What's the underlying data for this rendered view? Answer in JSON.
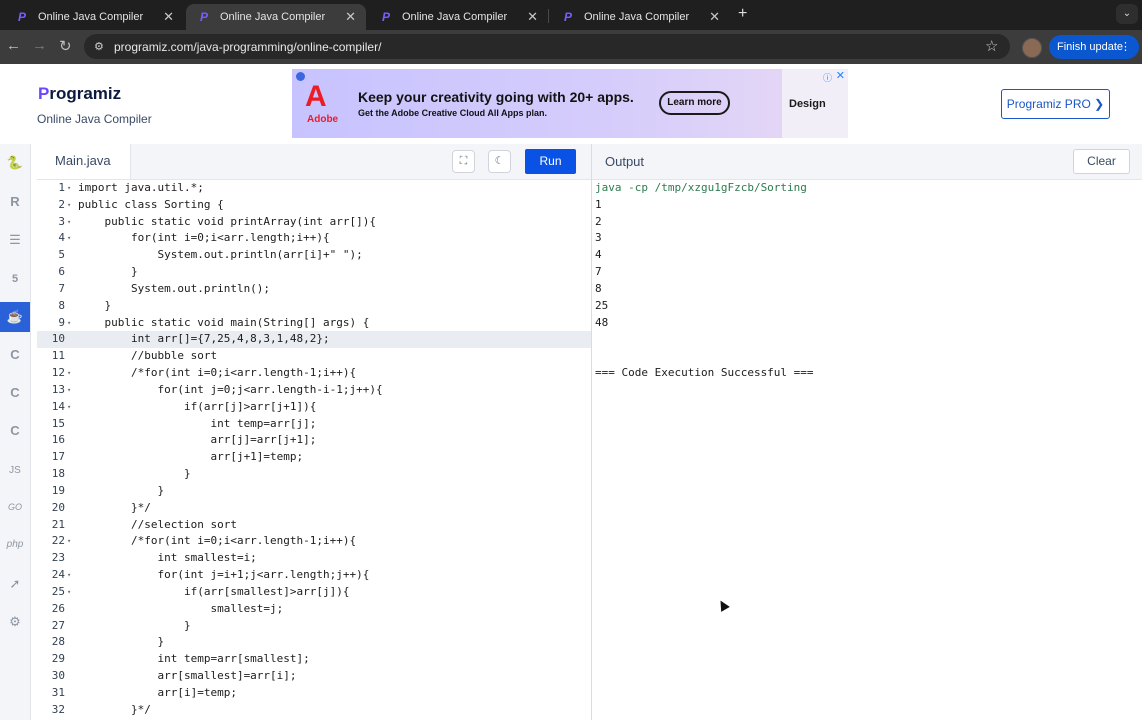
{
  "browser": {
    "tabs": [
      {
        "title": "Online Java Compiler",
        "active": false
      },
      {
        "title": "Online Java Compiler",
        "active": true
      },
      {
        "title": "Online Java Compiler",
        "active": false
      },
      {
        "title": "Online Java Compiler",
        "active": false
      }
    ],
    "url": "programiz.com/java-programming/online-compiler/",
    "update_button": "Finish update"
  },
  "header": {
    "logo": "rogramiz",
    "logo_initial": "P",
    "subtitle": "Online Java Compiler",
    "pro_button": "Programiz PRO ❯"
  },
  "ad": {
    "brand": "Adobe",
    "headline": "Keep your creativity going with 20+ apps.",
    "subline": "Get the Adobe Creative Cloud All Apps plan.",
    "cta": "Learn more",
    "tile": "Design"
  },
  "rail": {
    "items": [
      "python-icon",
      "r-icon",
      "sql-icon",
      "html-icon",
      "java-icon",
      "c-icon",
      "cpp-icon",
      "csharp-icon",
      "js-icon",
      "go-icon",
      "php-icon",
      "swift-icon",
      "rust-icon"
    ],
    "labels": {
      "js": "JS",
      "go": "GO",
      "php": "php"
    }
  },
  "editor": {
    "filename": "Main.java",
    "run_label": "Run",
    "lines": [
      {
        "n": "1",
        "fold": "▾",
        "text": "import java.util.*;"
      },
      {
        "n": "2",
        "fold": "▾",
        "text": "public class Sorting {"
      },
      {
        "n": "3",
        "fold": "▾",
        "text": "    public static void printArray(int arr[]){"
      },
      {
        "n": "4",
        "fold": "▾",
        "text": "        for(int i=0;i<arr.length;i++){"
      },
      {
        "n": "5",
        "fold": "",
        "text": "            System.out.println(arr[i]+\" \");"
      },
      {
        "n": "6",
        "fold": "",
        "text": "        }"
      },
      {
        "n": "7",
        "fold": "",
        "text": "        System.out.println();"
      },
      {
        "n": "8",
        "fold": "",
        "text": "    }"
      },
      {
        "n": "9",
        "fold": "▾",
        "text": "    public static void main(String[] args) {"
      },
      {
        "n": "10",
        "fold": "",
        "text": "        int arr[]={7,25,4,8,3,1,48,2};"
      },
      {
        "n": "11",
        "fold": "",
        "text": "        //bubble sort"
      },
      {
        "n": "12",
        "fold": "▾",
        "text": "        /*for(int i=0;i<arr.length-1;i++){"
      },
      {
        "n": "13",
        "fold": "▾",
        "text": "            for(int j=0;j<arr.length-i-1;j++){"
      },
      {
        "n": "14",
        "fold": "▾",
        "text": "                if(arr[j]>arr[j+1]){"
      },
      {
        "n": "15",
        "fold": "",
        "text": "                    int temp=arr[j];"
      },
      {
        "n": "16",
        "fold": "",
        "text": "                    arr[j]=arr[j+1];"
      },
      {
        "n": "17",
        "fold": "",
        "text": "                    arr[j+1]=temp;"
      },
      {
        "n": "18",
        "fold": "",
        "text": "                }"
      },
      {
        "n": "19",
        "fold": "",
        "text": "            }"
      },
      {
        "n": "20",
        "fold": "",
        "text": "        }*/"
      },
      {
        "n": "21",
        "fold": "",
        "text": "        //selection sort"
      },
      {
        "n": "22",
        "fold": "▾",
        "text": "        /*for(int i=0;i<arr.length-1;i++){"
      },
      {
        "n": "23",
        "fold": "",
        "text": "            int smallest=i;"
      },
      {
        "n": "24",
        "fold": "▾",
        "text": "            for(int j=i+1;j<arr.length;j++){"
      },
      {
        "n": "25",
        "fold": "▾",
        "text": "                if(arr[smallest]>arr[j]){"
      },
      {
        "n": "26",
        "fold": "",
        "text": "                    smallest=j;"
      },
      {
        "n": "27",
        "fold": "",
        "text": "                }"
      },
      {
        "n": "28",
        "fold": "",
        "text": "            }"
      },
      {
        "n": "29",
        "fold": "",
        "text": "            int temp=arr[smallest];"
      },
      {
        "n": "30",
        "fold": "",
        "text": "            arr[smallest]=arr[i];"
      },
      {
        "n": "31",
        "fold": "",
        "text": "            arr[i]=temp;"
      },
      {
        "n": "32",
        "fold": "",
        "text": "        }*/"
      }
    ],
    "highlighted_line": "10"
  },
  "output": {
    "title": "Output",
    "clear_label": "Clear",
    "command": "java -cp /tmp/xzgu1gFzcb/Sorting",
    "lines": [
      "1",
      "2",
      "3",
      "4",
      "7",
      "8",
      "25",
      "48",
      "",
      "",
      "=== Code Execution Successful ==="
    ]
  }
}
